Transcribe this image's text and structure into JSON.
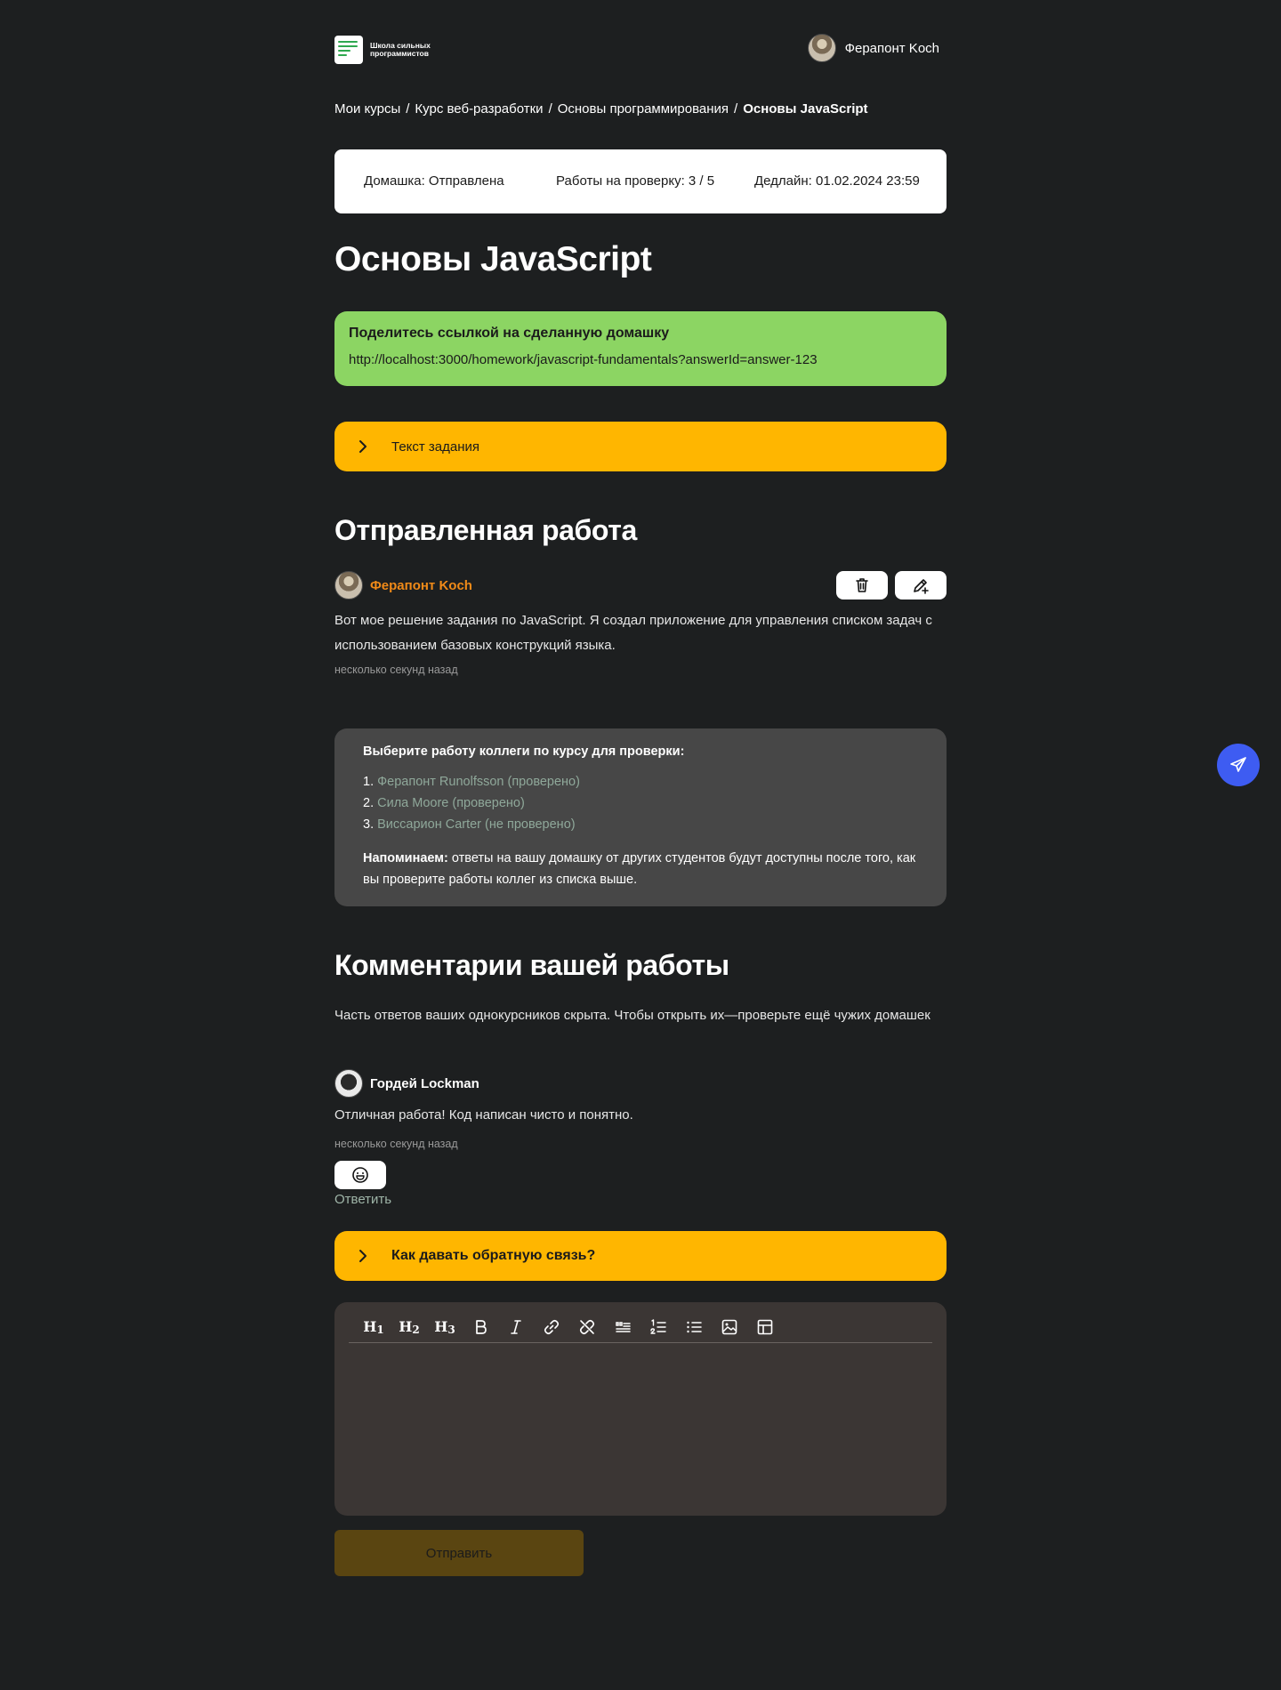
{
  "header": {
    "logo_text": "Школа сильных программистов",
    "user_name": "Ферапонт Koch"
  },
  "breadcrumb": {
    "items": [
      "Мои курсы",
      "/",
      "Курс веб-разработки",
      "/",
      "Основы программирования",
      "/"
    ],
    "current": "Основы JavaScript"
  },
  "status": {
    "homework": "Домашка: Отправлена",
    "reviews": "Работы на проверку: 3 / 5",
    "deadline": "Дедлайн: 01.02.2024 23:59"
  },
  "page_title": "Основы JavaScript",
  "share": {
    "title": "Поделитесь ссылкой на сделанную домашку",
    "link": "http://localhost:3000/homework/javascript-fundamentals?answerId=answer-123"
  },
  "task_accordion": {
    "label": "Текст задания"
  },
  "submission": {
    "section_title": "Отправленная работа",
    "author": "Ферапонт Koch",
    "text": "Вот мое решение задания по JavaScript. Я создал приложение для управления списком задач с использованием базовых конструкций языка.",
    "time": "несколько секунд назад"
  },
  "peer_review": {
    "title": "Выберите работу коллеги по курсу для проверки:",
    "items": [
      {
        "num": "1.",
        "label": "Ферапонт Runolfsson (проверено)"
      },
      {
        "num": "2.",
        "label": "Сила Moore (проверено)"
      },
      {
        "num": "3.",
        "label": "Виссарион Carter (не проверено)"
      }
    ],
    "note_bold": "Напоминаем:",
    "note_text": " ответы на вашу домашку от других студентов будут доступны после того, как вы проверите работы коллег из списка выше."
  },
  "comments": {
    "section_title": "Комментарии вашей работы",
    "hint": "Часть ответов ваших однокурсников скрыта. Чтобы открыть их—проверьте ещё чужих домашек",
    "items": [
      {
        "author": "Гордей Lockman",
        "text": "Отличная работа! Код написан чисто и понятно.",
        "time": "несколько секунд назад",
        "reply": "Ответить"
      }
    ]
  },
  "feedback_accordion": {
    "label": "Как давать обратную связь?"
  },
  "editor": {
    "toolbar": [
      "h1-icon",
      "h2-icon",
      "h3-icon",
      "bold-icon",
      "italic-icon",
      "link-icon",
      "unlink-icon",
      "blockquote-icon",
      "ordered-list-icon",
      "bullet-list-icon",
      "image-icon",
      "table-icon"
    ],
    "submit_label": "Отправить"
  },
  "colors": {
    "background": "#1d1f20",
    "accent_yellow": "#ffb600",
    "accent_green": "#8cd563",
    "author_orange": "#f08a18",
    "fab_blue": "#3e5cf2"
  }
}
